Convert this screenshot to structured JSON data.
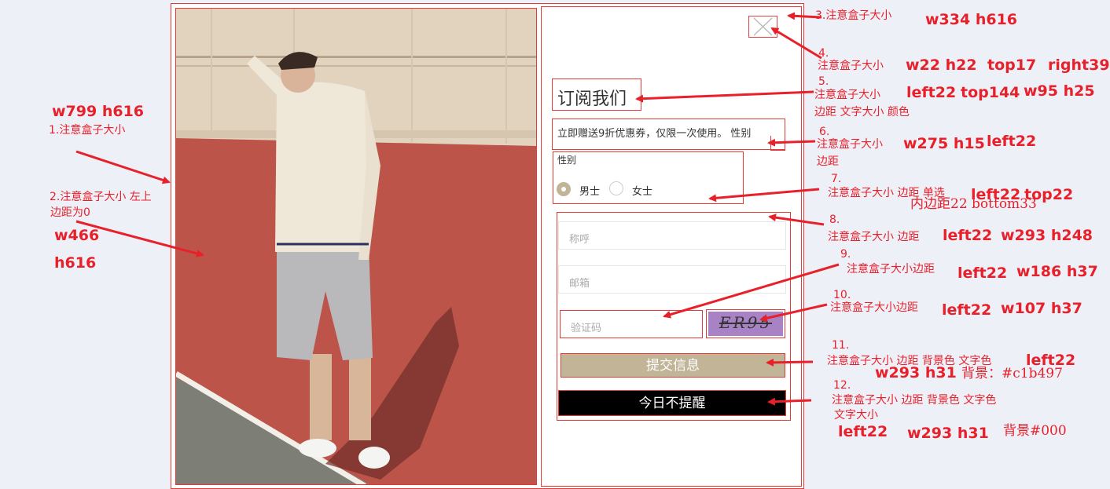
{
  "colors": {
    "accent": "#c1b497",
    "annotation": "#e8202a",
    "dismiss_bg": "#000000"
  },
  "modal": {
    "close_icon": "close-icon",
    "title": "订阅我们",
    "promo_text": "立即赠送9折优惠券，仅限一次使用。 性别",
    "gender": {
      "label": "性别",
      "options": [
        "男士",
        "女士"
      ],
      "selected": "男士"
    },
    "form": {
      "name_placeholder": "称呼",
      "email_placeholder": "邮箱",
      "captcha_placeholder": "验证码",
      "captcha_text": "ER95"
    },
    "submit_label": "提交信息",
    "dismiss_label": "今日不提醒"
  },
  "annotations": {
    "a1_size": "w799 h616",
    "a1_note": "1.注意盒子大小",
    "a2_note_1": "2.注意盒子大小 左上",
    "a2_note_2": "边距为0",
    "a2_w": "w466",
    "a2_h": "h616",
    "a3_note": "3.注意盒子大小",
    "a3_size": "w334 h616",
    "a4_num": "4.",
    "a4_note": "注意盒子大小",
    "a4_size": "w22 h22",
    "a4_top": "top17",
    "a4_right": "right39",
    "a5_num": "5.",
    "a5_note": "注意盒子大小",
    "a5_left": "left22",
    "a5_top": "top144",
    "a5_size": "w95 h25",
    "a5_note2": "边距  文字大小 颜色",
    "a6_num": "6.",
    "a6_note": "注意盒子大小",
    "a6_size": "w275 h15",
    "a6_left": "left22",
    "a6_note2": "边距",
    "a7_num": "7.",
    "a7_note": "注意盒子大小 边距 单选",
    "a7_left": "left22",
    "a7_top": "top22",
    "a7_padding": "内边距22 bottom33",
    "a8_num": "8.",
    "a8_note": "注意盒子大小 边距",
    "a8_left": "left22",
    "a8_size": "w293 h248",
    "a9_num": "9.",
    "a9_note": "注意盒子大小边距",
    "a9_left": "left22",
    "a9_size": "w186 h37",
    "a10_num": "10.",
    "a10_note": "注意盒子大小边距",
    "a10_left": "left22",
    "a10_size": "w107 h37",
    "a11_num": "11.",
    "a11_note": "注意盒子大小 边距  背景色 文字色",
    "a11_left": "left22",
    "a11_size": "w293 h31",
    "a11_bg": "背景：#c1b497",
    "a12_num": "12.",
    "a12_note": "注意盒子大小 边距  背景色 文字色",
    "a12_note2": "文字大小",
    "a12_left": "left22",
    "a12_size": "w293 h31",
    "a12_bg": "背景#000"
  }
}
